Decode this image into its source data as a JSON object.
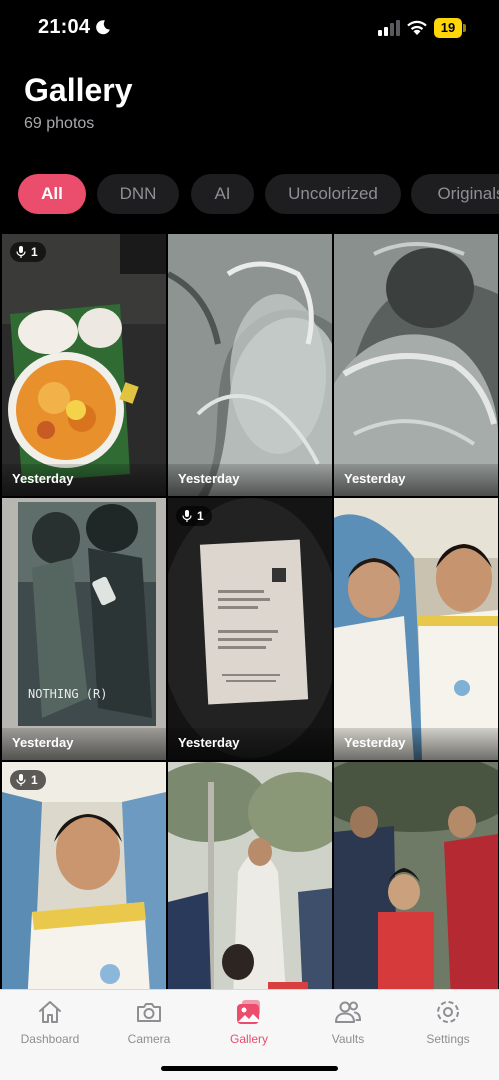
{
  "status_bar": {
    "time": "21:04",
    "battery": "19"
  },
  "header": {
    "title": "Gallery",
    "subtitle": "69 photos"
  },
  "filters": [
    {
      "label": "All",
      "active": true
    },
    {
      "label": "DNN",
      "active": false
    },
    {
      "label": "AI",
      "active": false
    },
    {
      "label": "Uncolorized",
      "active": false
    },
    {
      "label": "Originals",
      "active": false
    }
  ],
  "photos": [
    {
      "caption": "Yesterday",
      "badge": "1",
      "subject": "food-plate"
    },
    {
      "caption": "Yesterday",
      "badge": "",
      "subject": "glass-texture"
    },
    {
      "caption": "Yesterday",
      "badge": "",
      "subject": "glass-texture"
    },
    {
      "caption": "Yesterday",
      "badge": "",
      "subject": "poster"
    },
    {
      "caption": "Yesterday",
      "badge": "1",
      "subject": "document"
    },
    {
      "caption": "Yesterday",
      "badge": "",
      "subject": "children-photo"
    },
    {
      "caption": "",
      "badge": "1",
      "subject": "boy-portrait"
    },
    {
      "caption": "",
      "badge": "",
      "subject": "crowd-outdoors"
    },
    {
      "caption": "",
      "badge": "",
      "subject": "crowd-outdoors"
    }
  ],
  "poster_text": "NOTHING (R)",
  "tabs": [
    {
      "label": "Dashboard",
      "icon": "home-icon",
      "active": false
    },
    {
      "label": "Camera",
      "icon": "camera-icon",
      "active": false
    },
    {
      "label": "Gallery",
      "icon": "gallery-icon",
      "active": true
    },
    {
      "label": "Vaults",
      "icon": "users-icon",
      "active": false
    },
    {
      "label": "Settings",
      "icon": "gear-icon",
      "active": false
    }
  ],
  "colors": {
    "accent": "#eb4d6d",
    "chip_bg": "#1e1e20",
    "tabbar_bg": "#f7f7f8"
  }
}
